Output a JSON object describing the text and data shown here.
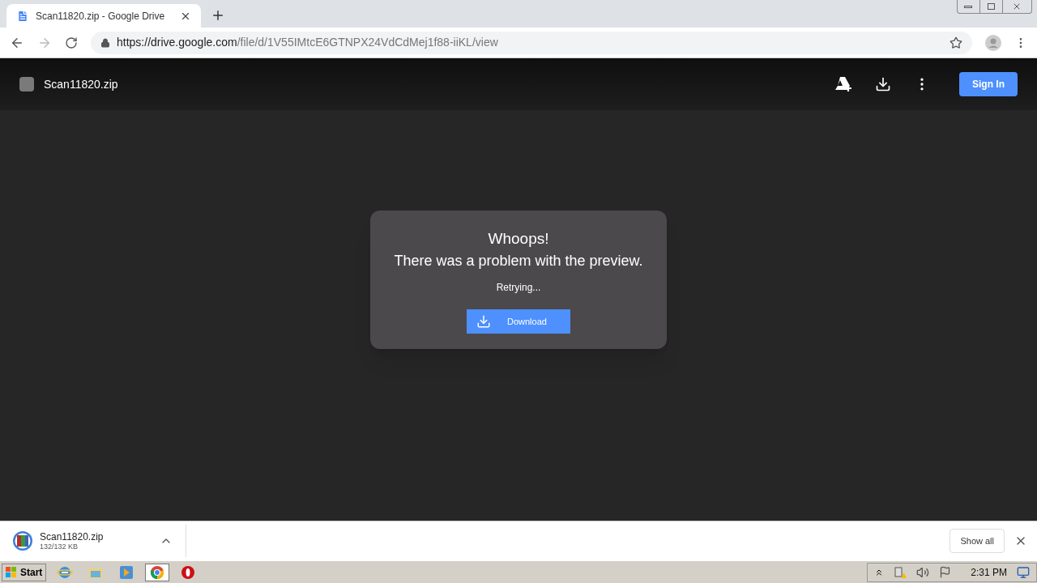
{
  "browser": {
    "tab": {
      "title": "Scan11820.zip - Google Drive",
      "selected": true
    },
    "url_host": "https://drive.google.com",
    "url_path": "/file/d/1V55IMtcE6GTNPX24VdCdMej1f88-iiKL/view"
  },
  "viewer": {
    "file_name": "Scan11820.zip",
    "sign_in": "Sign In"
  },
  "dialog": {
    "title": "Whoops!",
    "message": "There was a problem with the preview.",
    "status": "Retrying...",
    "button": "Download"
  },
  "downloads": {
    "items": [
      {
        "name": "Scan11820.zip",
        "size": "132/132 KB"
      }
    ],
    "show_all": "Show all"
  },
  "taskbar": {
    "start": "Start",
    "apps": [
      {
        "kind": "ie",
        "selected": false
      },
      {
        "kind": "folder",
        "selected": false
      },
      {
        "kind": "media",
        "selected": false
      },
      {
        "kind": "chrome",
        "selected": true
      },
      {
        "kind": "opera",
        "selected": false
      }
    ],
    "clock": "2:31 PM"
  }
}
